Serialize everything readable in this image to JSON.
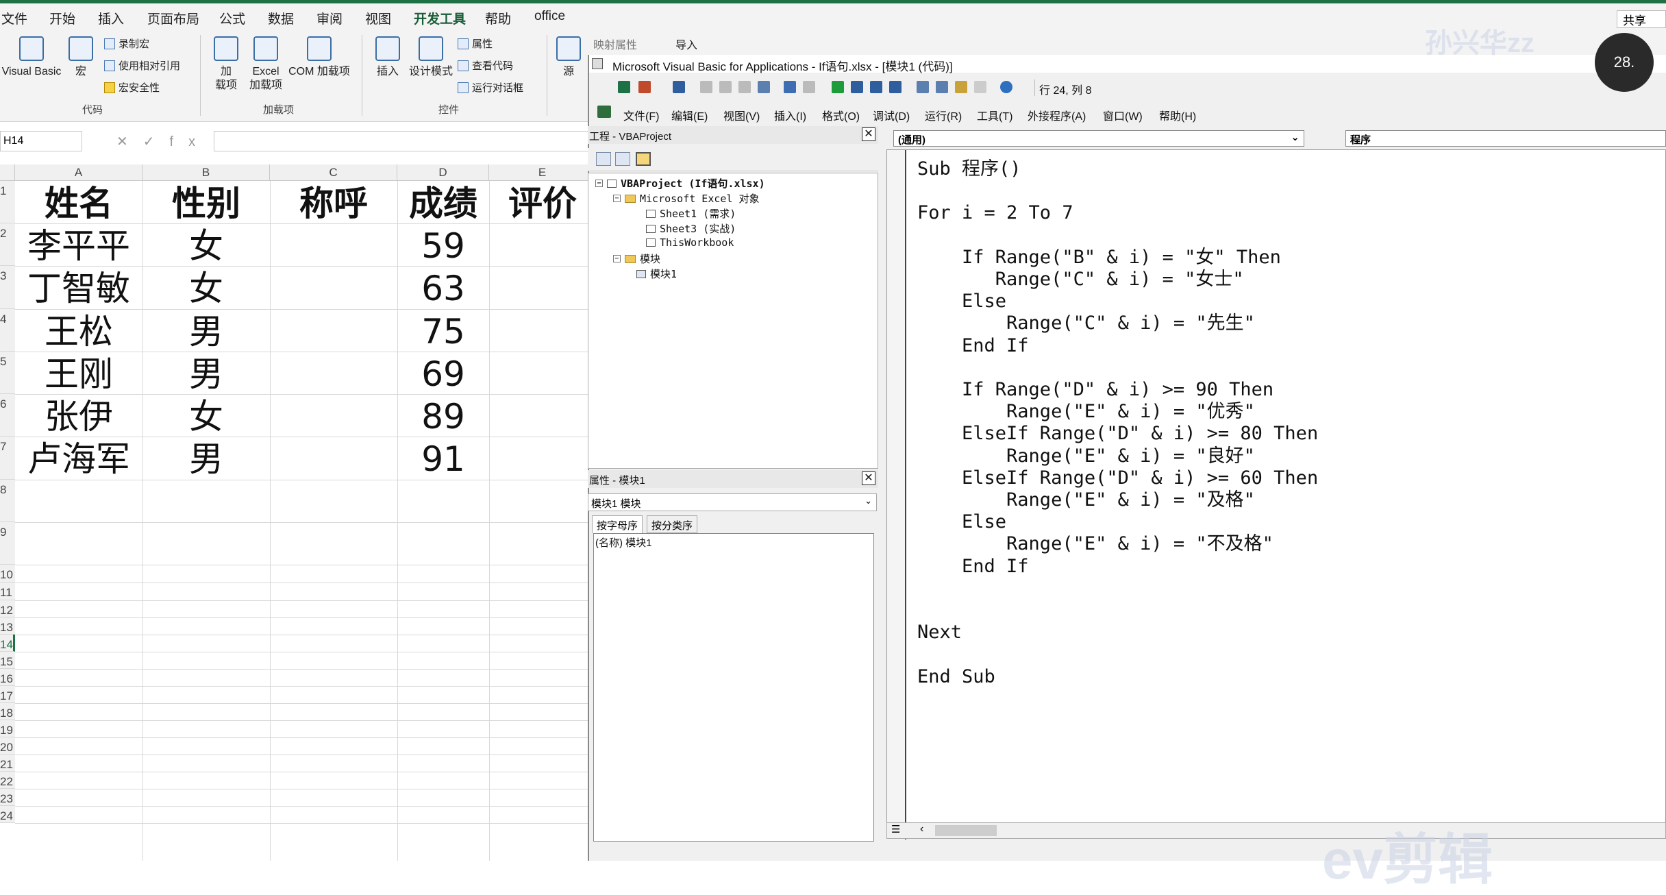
{
  "excel": {
    "menu_tabs": [
      "文件",
      "开始",
      "插入",
      "页面布局",
      "公式",
      "数据",
      "审阅",
      "视图",
      "开发工具",
      "帮助",
      "office"
    ],
    "active_tab": "开发工具",
    "share_label": "共享",
    "ribbon": {
      "visual_basic": "Visual Basic",
      "macro": "宏",
      "record_macro": "录制宏",
      "relative_ref": "使用相对引用",
      "macro_security": "宏安全性",
      "group_code": "代码",
      "addins": "加\n载项",
      "excel_addins": "Excel\n加载项",
      "com_addins": "COM 加载项",
      "group_addins": "加载项",
      "insert": "插入",
      "design_mode": "设计模式",
      "properties": "属性",
      "view_code": "查看代码",
      "run_dialog": "运行对话框",
      "group_controls": "控件",
      "source": "源",
      "map_props": "映射属性",
      "import": "导入"
    },
    "name_box": "H14",
    "fx_label": "fx",
    "columns": [
      "A",
      "B",
      "C",
      "D",
      "E"
    ],
    "row_numbers": [
      "1",
      "2",
      "3",
      "4",
      "5",
      "6",
      "7",
      "8",
      "9",
      "10",
      "11",
      "12",
      "13",
      "14",
      "15",
      "16",
      "17",
      "18",
      "19",
      "20",
      "21",
      "22",
      "23",
      "24"
    ],
    "selected_row": "14",
    "headers": [
      "姓名",
      "性别",
      "称呼",
      "成绩",
      "评价"
    ],
    "rows": [
      [
        "李平平",
        "女",
        "",
        "59",
        ""
      ],
      [
        "丁智敏",
        "女",
        "",
        "63",
        ""
      ],
      [
        "王松",
        "男",
        "",
        "75",
        ""
      ],
      [
        "王刚",
        "男",
        "",
        "69",
        ""
      ],
      [
        "张伊",
        "女",
        "",
        "89",
        ""
      ],
      [
        "卢海军",
        "男",
        "",
        "91",
        ""
      ]
    ]
  },
  "vbe": {
    "title": "Microsoft Visual Basic for Applications - If语句.xlsx - [模块1 (代码)]",
    "row_col": "行 24, 列 8",
    "menus": [
      "文件(F)",
      "编辑(E)",
      "视图(V)",
      "插入(I)",
      "格式(O)",
      "调试(D)",
      "运行(R)",
      "工具(T)",
      "外接程序(A)",
      "窗口(W)",
      "帮助(H)"
    ],
    "project_pane_title": "工程 - VBAProject",
    "tree": {
      "project": "VBAProject (If语句.xlsx)",
      "excel_objects": "Microsoft Excel 对象",
      "sheet1": "Sheet1 (需求)",
      "sheet3": "Sheet3 (实战)",
      "thisworkbook": "ThisWorkbook",
      "modules": "模块",
      "module1": "模块1"
    },
    "properties_pane_title": "属性 - 模块1",
    "prop_object": "模块1 模块",
    "prop_tabs": [
      "按字母序",
      "按分类序"
    ],
    "prop_row": "(名称) 模块1",
    "code_object": "(通用)",
    "code_proc": "程序",
    "code_lines": [
      "Sub 程序()",
      "",
      "For i = 2 To 7",
      "",
      "    If Range(\"B\" & i) = \"女\" Then",
      "       Range(\"C\" & i) = \"女士\"",
      "    Else",
      "        Range(\"C\" & i) = \"先生\"",
      "    End If",
      "",
      "    If Range(\"D\" & i) >= 90 Then",
      "        Range(\"E\" & i) = \"优秀\"",
      "    ElseIf Range(\"D\" & i) >= 80 Then",
      "        Range(\"E\" & i) = \"良好\"",
      "    ElseIf Range(\"D\" & i) >= 60 Then",
      "        Range(\"E\" & i) = \"及格\"",
      "    Else",
      "        Range(\"E\" & i) = \"不及格\"",
      "    End If",
      "",
      "",
      "Next",
      "",
      "End Sub"
    ]
  },
  "overlay": {
    "avatar_text": "28.",
    "watermark_top": "孙兴华zz",
    "watermark_bottom": "ev剪辑"
  }
}
